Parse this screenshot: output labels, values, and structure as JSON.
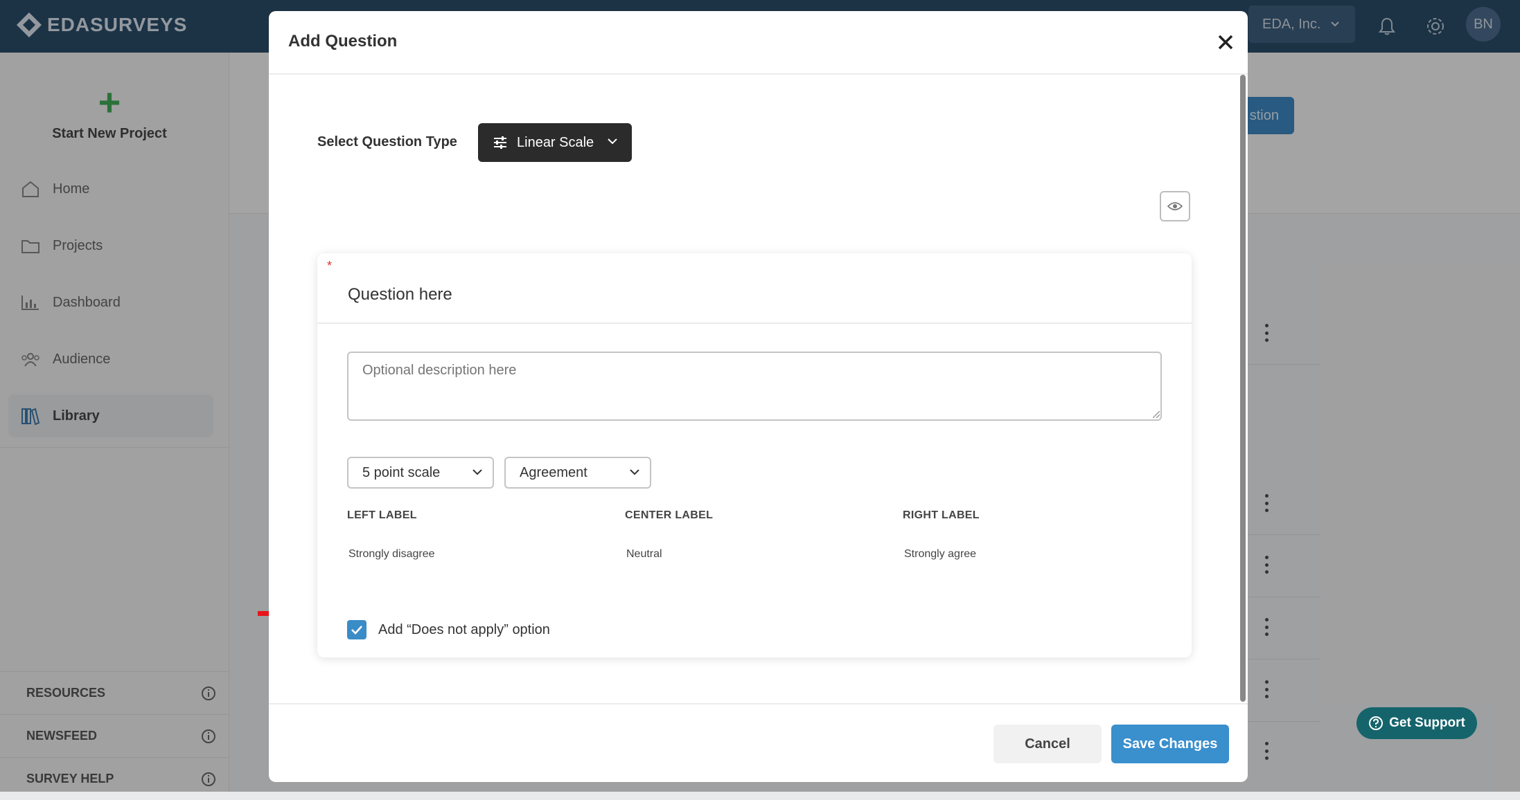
{
  "app": {
    "logo_text": "EDASURVEYS",
    "org_name": "EDA, Inc.",
    "avatar_initials": "BN"
  },
  "sidebar": {
    "new_project_label": "Start New Project",
    "items": [
      {
        "label": "Home",
        "icon": "home-icon"
      },
      {
        "label": "Projects",
        "icon": "folder-icon"
      },
      {
        "label": "Dashboard",
        "icon": "bar-chart-icon"
      },
      {
        "label": "Audience",
        "icon": "people-icon"
      },
      {
        "label": "Library",
        "icon": "library-icon",
        "active": true
      }
    ],
    "resources": [
      {
        "label": "RESOURCES"
      },
      {
        "label": "NEWSFEED"
      },
      {
        "label": "SURVEY HELP"
      }
    ]
  },
  "background": {
    "button_label": "stion"
  },
  "modal": {
    "title": "Add Question",
    "select_question_type_label": "Select Question Type",
    "question_type": "Linear Scale",
    "question_placeholder": "Question here",
    "description_placeholder": "Optional description here",
    "scale_select": "5 point scale",
    "label_type_select": "Agreement",
    "columns": [
      {
        "header": "LEFT LABEL",
        "value": "Strongly disagree"
      },
      {
        "header": "CENTER LABEL",
        "value": "Neutral"
      },
      {
        "header": "RIGHT LABEL",
        "value": "Strongly agree"
      }
    ],
    "does_not_apply_label": "Add “Does not apply” option",
    "does_not_apply_checked": true,
    "cancel_label": "Cancel",
    "save_label": "Save Changes"
  },
  "support": {
    "label": "Get Support"
  },
  "colors": {
    "topbar": "#163a5a",
    "primary": "#3a8fcd",
    "support": "#15646c",
    "annotation_arrow": "#e8161b"
  }
}
